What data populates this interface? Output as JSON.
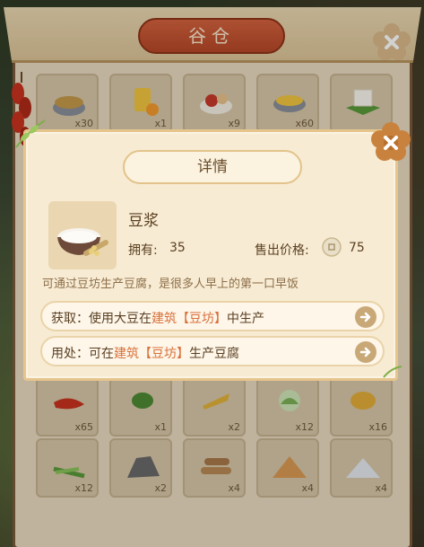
{
  "granary": {
    "title": "谷仓",
    "top_counts": [
      "x30",
      "x1",
      "x9",
      "x60",
      ""
    ],
    "row2_counts": [
      "x65",
      "x1",
      "x2",
      "x12",
      "x16"
    ],
    "row3_counts": [
      "x12",
      "x2",
      "x4",
      "x4",
      "x4"
    ]
  },
  "detail": {
    "title": "详情",
    "item_name": "豆浆",
    "own_label": "拥有:",
    "own_value": "35",
    "price_label": "售出价格:",
    "price_value": "75",
    "description": "可通过豆坊生产豆腐，是很多人早上的第一口早饭",
    "obtain": {
      "prefix": "获取：使用大豆在",
      "link": "建筑【豆坊】",
      "suffix": "中生产"
    },
    "usage": {
      "prefix": "用处：可在",
      "link": "建筑【豆坊】",
      "suffix": "生产豆腐"
    }
  },
  "colors": {
    "accent": "#d9703a",
    "title_red": "#c4532f",
    "close_flower": "#c9823e"
  },
  "icons": [
    "close-icon",
    "coin-icon",
    "arrow-right-icon",
    "soy-milk-icon"
  ]
}
